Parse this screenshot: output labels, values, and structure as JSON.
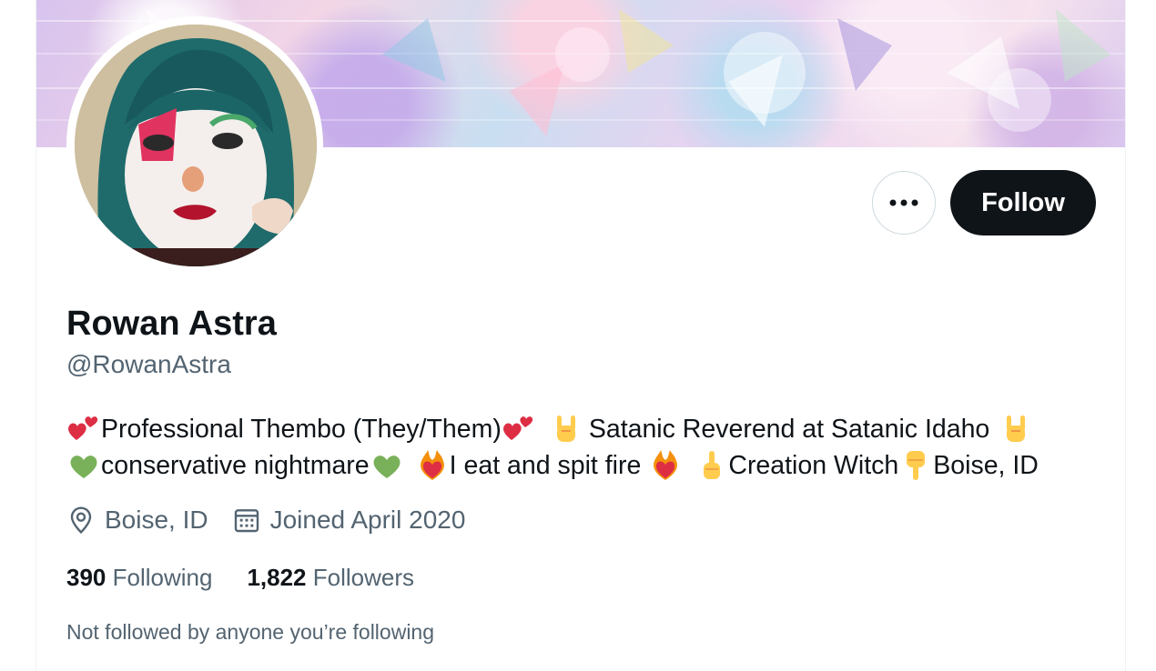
{
  "profile": {
    "display_name": "Rowan Astra",
    "handle": "@RowanAstra",
    "follow_label": "Follow",
    "more_icon": "more-horizontal-icon"
  },
  "bio": {
    "line1": [
      {
        "type": "emoji",
        "icon": "two-hearts-icon"
      },
      {
        "type": "text",
        "value": "Professional Thembo (They/Them)"
      },
      {
        "type": "emoji",
        "icon": "two-hearts-icon"
      },
      {
        "type": "emoji",
        "icon": "sign-of-horns-icon"
      },
      {
        "type": "text",
        "value": "Satanic Reverend at Satanic Idaho"
      },
      {
        "type": "emoji",
        "icon": "sign-of-horns-icon"
      }
    ],
    "line2": [
      {
        "type": "emoji",
        "icon": "green-heart-icon"
      },
      {
        "type": "text",
        "value": "conservative nightmare"
      },
      {
        "type": "emoji",
        "icon": "green-heart-icon"
      },
      {
        "type": "emoji",
        "icon": "heart-on-fire-icon"
      },
      {
        "type": "text",
        "value": "I eat and spit fire"
      },
      {
        "type": "emoji",
        "icon": "heart-on-fire-icon"
      },
      {
        "type": "emoji",
        "icon": "point-up-icon"
      },
      {
        "type": "text",
        "value": "Creation Witch"
      },
      {
        "type": "emoji",
        "icon": "point-down-icon"
      },
      {
        "type": "text",
        "value": "Boise, ID"
      }
    ],
    "t1": "Professional Thembo (They/Them)",
    "t2": "Satanic Reverend at Satanic Idaho",
    "t3": "conservative nightmare",
    "t4": "I eat and spit fire",
    "t5": "Creation Witch",
    "t6": "Boise, ID"
  },
  "meta": {
    "location": "Boise, ID",
    "location_icon": "location-pin-icon",
    "joined": "Joined April 2020",
    "joined_icon": "calendar-icon"
  },
  "stats": {
    "following_count": "390",
    "following_label": "Following",
    "followers_count": "1,822",
    "followers_label": "Followers"
  },
  "social_context": "Not followed by anyone you’re following",
  "colors": {
    "primary_text": "#0f1419",
    "secondary_text": "#536471",
    "follow_button_bg": "#0f1419",
    "border": "#cfd9de"
  }
}
